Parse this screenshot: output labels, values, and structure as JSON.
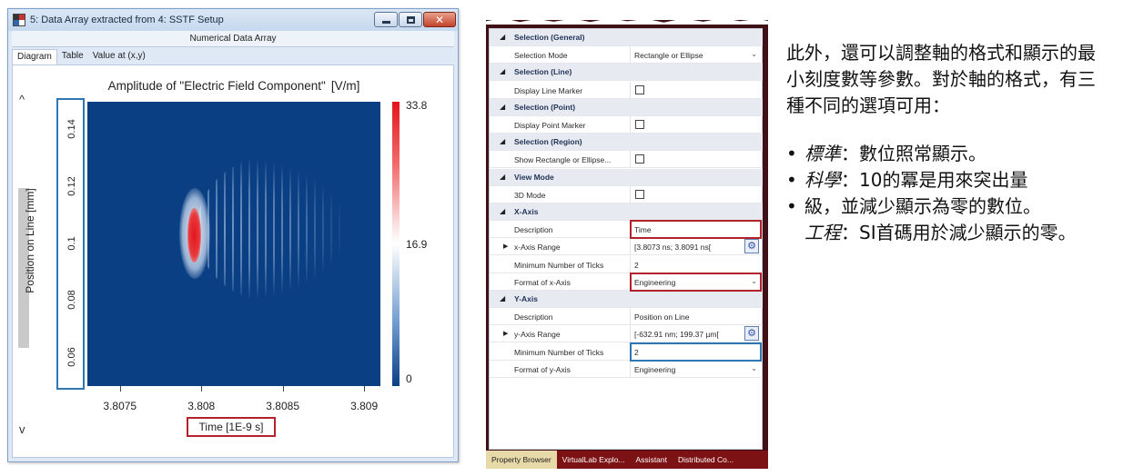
{
  "window": {
    "title": "5: Data Array extracted from 4: SSTF Setup",
    "subheader": "Numerical Data Array",
    "tabs": [
      "Diagram",
      "Table",
      "Value at (x,y)"
    ],
    "scroll_up": "^",
    "scroll_down": "v",
    "close_glyph": "✕"
  },
  "chart_data": {
    "type": "heatmap",
    "title": "Amplitude of \"Electric Field Component\"",
    "title_unit": "[V/m]",
    "xlabel": "Time [1E-9 s]",
    "ylabel": "Position on Line [mm]",
    "x_ticks": [
      "3.8075",
      "3.808",
      "3.8085",
      "3.809"
    ],
    "y_ticks": [
      "0.14",
      "0.12",
      "0.1",
      "0.08",
      "0.06"
    ],
    "xlim": [
      3.8073,
      3.8091
    ],
    "ylim": [
      0.05,
      0.15
    ],
    "colorbar": {
      "max": "33.8",
      "mid": "16.9",
      "min": "0"
    },
    "colors": {
      "low": "#0a3f84",
      "mid": "#ffffff",
      "high": "#e3161d"
    },
    "peak": {
      "x": 3.808,
      "y": 0.1,
      "value": 33.8
    }
  },
  "property_browser": {
    "rows": [
      {
        "kind": "section",
        "label": "Selection (General)"
      },
      {
        "kind": "prop",
        "label": "Selection Mode",
        "value": "Rectangle or Ellipse",
        "control": "dropdown"
      },
      {
        "kind": "section",
        "label": "Selection (Line)"
      },
      {
        "kind": "prop",
        "label": "Display Line Marker",
        "control": "checkbox"
      },
      {
        "kind": "section",
        "label": "Selection (Point)"
      },
      {
        "kind": "prop",
        "label": "Display Point Marker",
        "control": "checkbox"
      },
      {
        "kind": "section",
        "label": "Selection (Region)"
      },
      {
        "kind": "prop",
        "label": "Show Rectangle or Ellipse...",
        "control": "checkbox"
      },
      {
        "kind": "section",
        "label": "View Mode"
      },
      {
        "kind": "prop",
        "label": "3D Mode",
        "control": "checkbox"
      },
      {
        "kind": "section",
        "label": "X-Axis"
      },
      {
        "kind": "prop",
        "label": "Description",
        "value": "Time",
        "control": "text"
      },
      {
        "kind": "prop",
        "label": "x-Axis Range",
        "value": "[3.8073 ns; 3.8091 ns[",
        "control": "range"
      },
      {
        "kind": "prop",
        "label": "Minimum Number of Ticks",
        "value": "2",
        "control": "text"
      },
      {
        "kind": "prop",
        "label": "Format of x-Axis",
        "value": "Engineering",
        "control": "dropdown"
      },
      {
        "kind": "section",
        "label": "Y-Axis"
      },
      {
        "kind": "prop",
        "label": "Description",
        "value": "Position on Line",
        "control": "text"
      },
      {
        "kind": "prop",
        "label": "y-Axis Range",
        "value": "[-632.91 nm; 199.37 µm[",
        "control": "range"
      },
      {
        "kind": "prop",
        "label": "Minimum Number of Ticks",
        "value": "2",
        "control": "text"
      },
      {
        "kind": "prop",
        "label": "Format of y-Axis",
        "value": "Engineering",
        "control": "dropdown"
      }
    ],
    "tabs": [
      "Property Browser",
      "VirtualLab Explo...",
      "Assistant",
      "Distributed Co..."
    ],
    "active_tab": "Property Browser",
    "section_glyph": "◢",
    "expander_glyph": "▶",
    "dropdown_glyph": "⌄",
    "gear_glyph": "⚙"
  },
  "notes": {
    "paragraph": "此外，還可以調整軸的格式和顯示的最小刻度數等參數。對於軸的格式，有三種不同的選項可用：",
    "bullet": "•",
    "items": [
      {
        "term": "標準",
        "text": "：數位照常顯示。"
      },
      {
        "term": "科學",
        "text": "：10的冪是用來突出量"
      },
      {
        "term": "",
        "text": "級，並減少顯示為零的數位。"
      },
      {
        "term": "工程",
        "text": "：SI首碼用於減少顯示的零。"
      }
    ]
  }
}
